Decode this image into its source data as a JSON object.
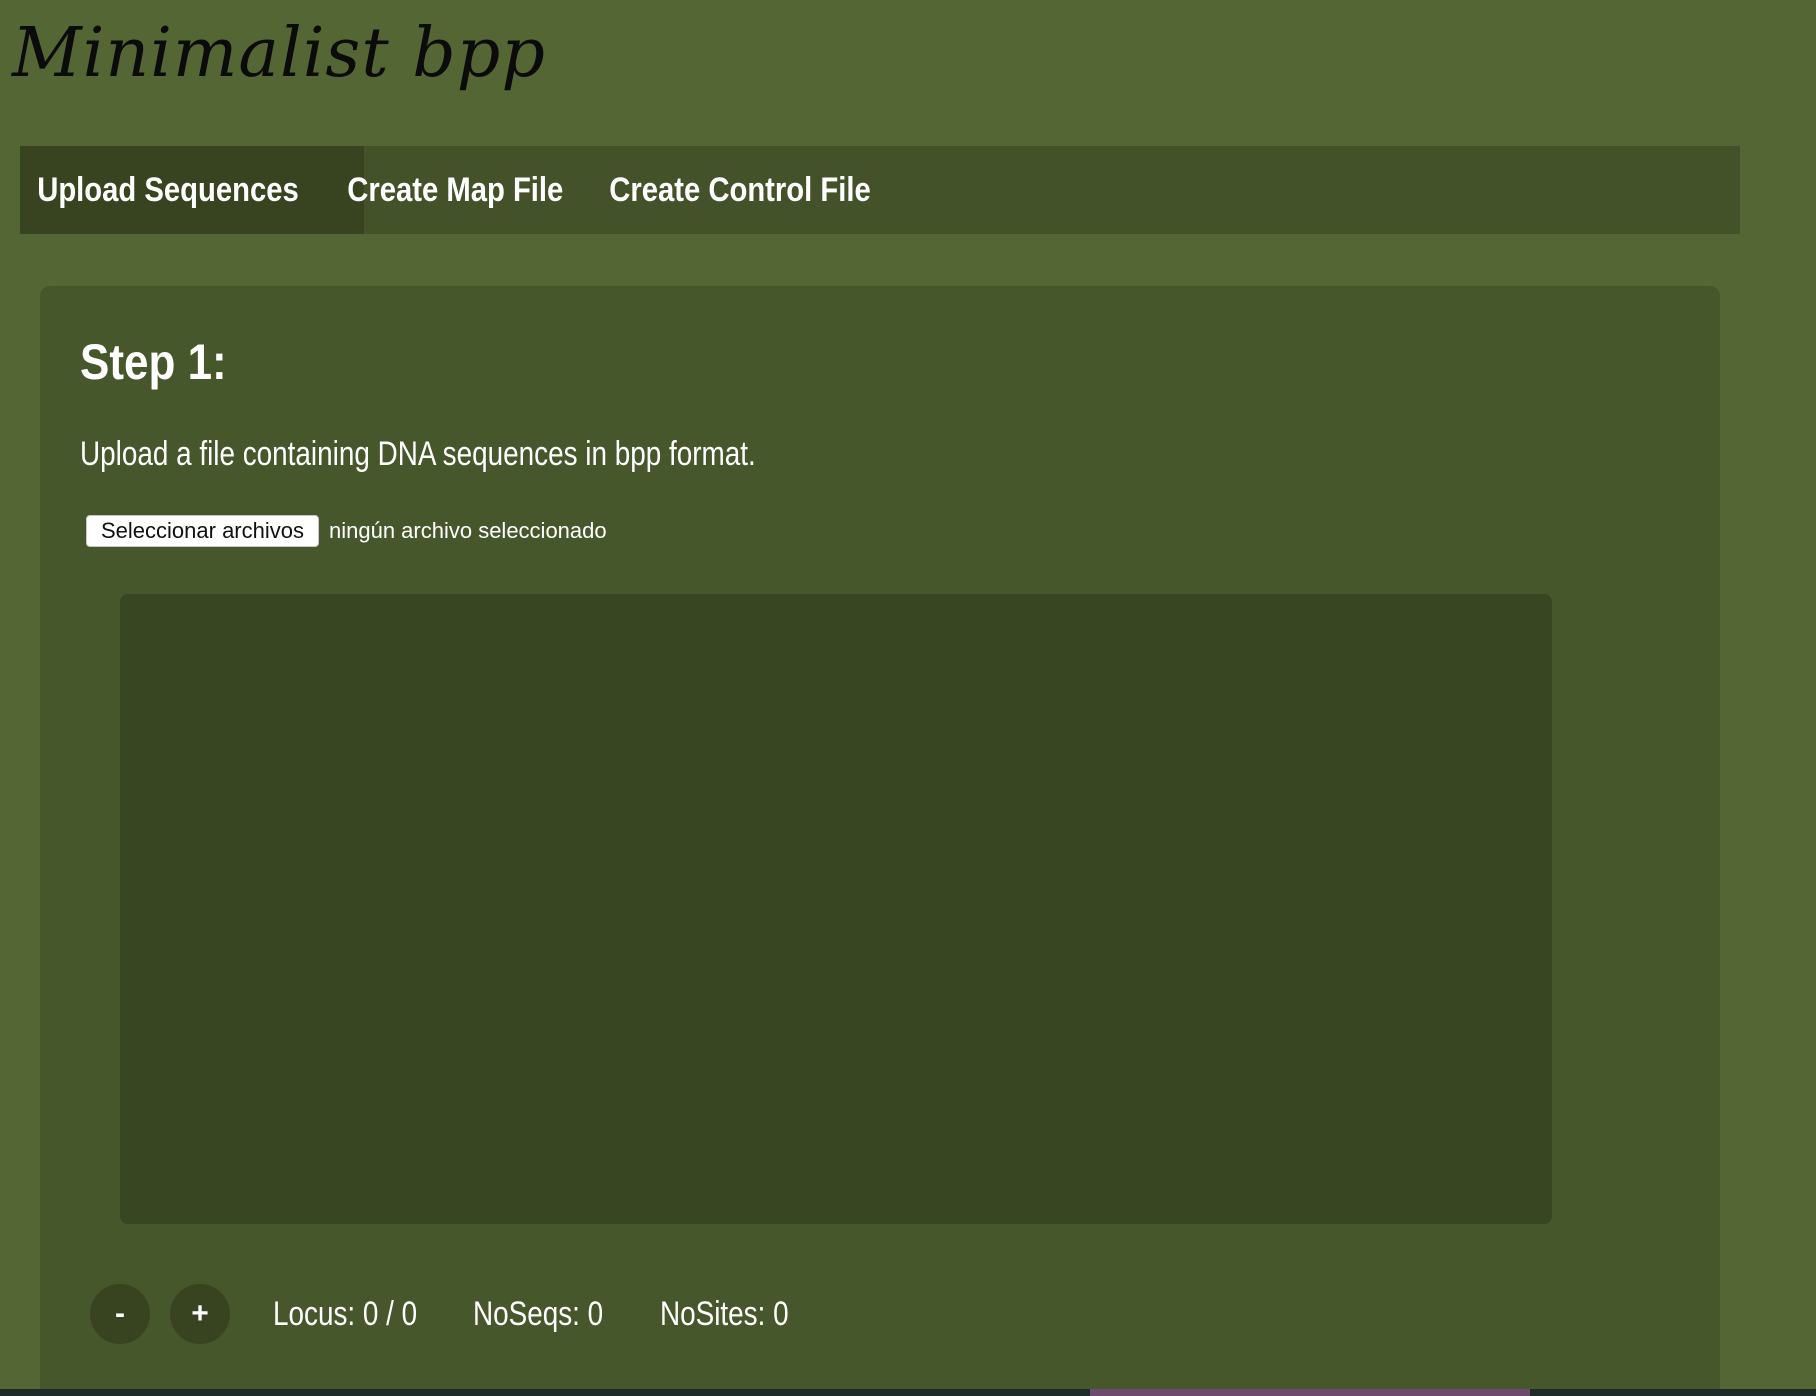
{
  "app": {
    "title": "Minimalist bpp"
  },
  "nav": {
    "tabs": [
      {
        "label": "Upload Sequences",
        "active": true
      },
      {
        "label": "Create Map File",
        "active": false
      },
      {
        "label": "Create Control File",
        "active": false
      }
    ]
  },
  "step": {
    "title": "Step 1:",
    "description": "Upload a file containing DNA sequences in bpp format."
  },
  "file_input": {
    "button_label": "Seleccionar archivos",
    "status_text": "ningún archivo seleccionado"
  },
  "controls": {
    "decrease_label": "-",
    "increase_label": "+",
    "locus_text": "Locus: 0 / 0",
    "noseqs_text": "NoSeqs: 0",
    "nosites_text": "NoSites: 0"
  },
  "colors": {
    "page_background": "#556635",
    "nav_background": "#435229",
    "active_tab": "#37441f",
    "panel_background": "#46572b",
    "sequence_view": "#384622"
  }
}
